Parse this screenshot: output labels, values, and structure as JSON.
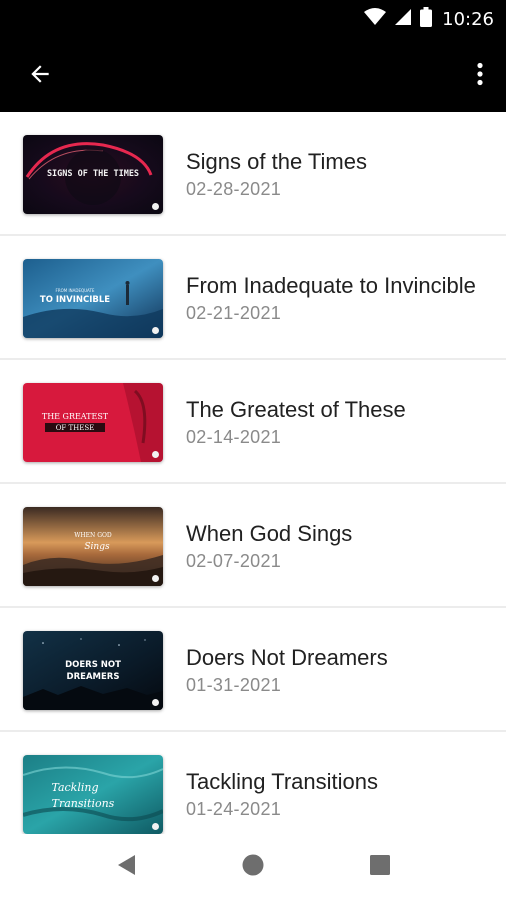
{
  "status_bar": {
    "time": "10:26",
    "icons": [
      "wifi-icon",
      "cell-signal-icon",
      "battery-icon"
    ]
  },
  "app_bar": {
    "back_icon": "arrow-left-icon",
    "menu_icon": "more-vert-icon",
    "background": "#000000"
  },
  "sermons": [
    {
      "title": "Signs of the Times",
      "date": "02-28-2021",
      "thumbnail": {
        "line1": "SIGNS OF THE TIMES",
        "line2": "",
        "subtitle": ""
      }
    },
    {
      "title": "From Inadequate to Invincible",
      "date": "02-21-2021",
      "thumbnail": {
        "line1": "TO INVINCIBLE",
        "line2": "",
        "subtitle": "FROM INADEQUATE"
      }
    },
    {
      "title": "The Greatest of These",
      "date": "02-14-2021",
      "thumbnail": {
        "line1": "THE GREATEST",
        "line2": "OF THESE",
        "subtitle": ""
      }
    },
    {
      "title": "When God Sings",
      "date": "02-07-2021",
      "thumbnail": {
        "line1": "WHEN GOD",
        "line2": "Sings",
        "subtitle": ""
      }
    },
    {
      "title": "Doers Not Dreamers",
      "date": "01-31-2021",
      "thumbnail": {
        "line1": "DOERS NOT",
        "line2": "DREAMERS",
        "subtitle": ""
      }
    },
    {
      "title": "Tackling Transitions",
      "date": "01-24-2021",
      "thumbnail": {
        "line1": "Tackling",
        "line2": "Transitions",
        "subtitle": ""
      }
    }
  ],
  "nav_bar": {
    "buttons": [
      "back-triangle-icon",
      "home-circle-icon",
      "recents-square-icon"
    ]
  }
}
